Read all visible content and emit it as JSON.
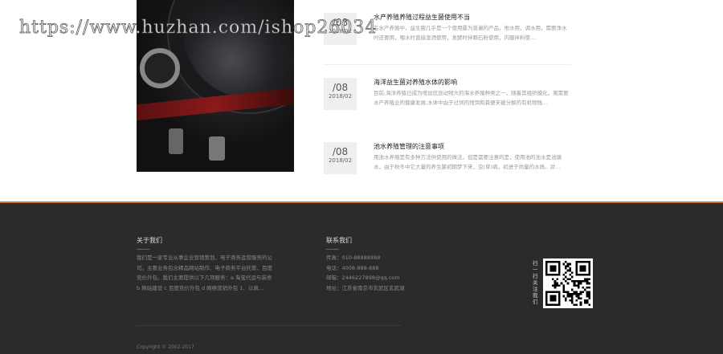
{
  "watermark": "https://www.huzhan.com/ishop26034",
  "news": [
    {
      "day": "/08",
      "ym": "2018/02",
      "title": "水产养殖养殖过程益生菌使用不当",
      "desc": "在水产养殖中，益生菌几乎是一个使用最为普遍的产品，地水用，调水用，需要净水时还要用，喂水时直接泼洒使用，发酵时拌颗石粉使用，内服拌料使..."
    },
    {
      "day": "/08",
      "ym": "2018/02",
      "title": "海洋益生菌对养殖水体的影响",
      "desc": "目前,海洋养殖已成为增加优良动物大的海水养殖种类之一，随着其组织模化，离需要水产养殖业的健康发展,水体中由于过饲的残饵和粪便未被分解的有机物残..."
    },
    {
      "day": "/08",
      "ym": "2018/02",
      "title": "池水养殖管理的注意事项",
      "desc": "用池水养殖是有多种方法供使用的做法，但是需要注意的是，使用池的池水是池塘水，由于秋冬中它大量的养生菌初期梦下来，虫(草)病，初进于尚量的水质。对..."
    }
  ],
  "footer": {
    "about_title": "关于我们",
    "about_text": "我们是一家专业从事企业营销策划、电子商务运营服务的公司。主要业务包含精品网站制作、电子商务平台托管、百度竞价外包。我们主要提供以下几项服务：a 淘宝代运与装修 b 网站建设 c 百度竞价外包 d 网络营销外包 1、以真...",
    "contact_title": "联系我们",
    "contact": [
      "传真：010-88888888",
      "电话：4008-888-888",
      "邮箱：2446227898@qq.com",
      "地址：江苏省南京市玄武区玄武湖"
    ],
    "qr_label": "扫一扫关注我们",
    "copyright": "Copyright © 2002-2017"
  }
}
